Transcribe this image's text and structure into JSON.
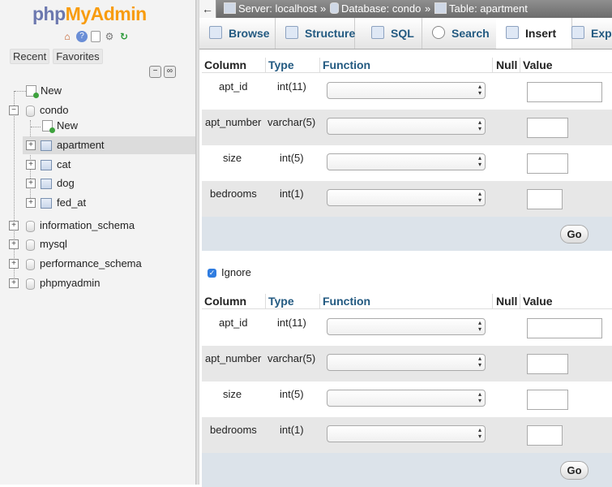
{
  "app": {
    "logo_part1": "php",
    "logo_part2": "MyAdmin"
  },
  "nav": {
    "icons": [
      "home-icon",
      "help-icon",
      "docs-icon",
      "settings-icon",
      "reload-icon"
    ],
    "tabs": [
      "Recent",
      "Favorites"
    ],
    "tree": {
      "new": "New",
      "databases": [
        {
          "name": "condo",
          "expanded": true,
          "new": "New",
          "tables": [
            "apartment",
            "cat",
            "dog",
            "fed_at"
          ],
          "selected_table": "apartment"
        },
        {
          "name": "information_schema"
        },
        {
          "name": "mysql"
        },
        {
          "name": "performance_schema"
        },
        {
          "name": "phpmyadmin"
        }
      ]
    }
  },
  "breadcrumb": {
    "server": "Server: localhost",
    "database": "Database: condo",
    "table": "Table: apartment",
    "separator": "»"
  },
  "tabs": [
    {
      "label": "Browse"
    },
    {
      "label": "Structure"
    },
    {
      "label": "SQL"
    },
    {
      "label": "Search"
    },
    {
      "label": "Insert",
      "active": true
    },
    {
      "label": "Exp"
    }
  ],
  "insert_form": {
    "headers": {
      "column": "Column",
      "type": "Type",
      "function": "Function",
      "null": "Null",
      "value": "Value"
    },
    "rows": [
      {
        "column": "apt_id",
        "type": "int(11)",
        "function": "",
        "value": ""
      },
      {
        "column": "apt_number",
        "type": "varchar(5)",
        "function": "",
        "value": ""
      },
      {
        "column": "size",
        "type": "int(5)",
        "function": "",
        "value": ""
      },
      {
        "column": "bedrooms",
        "type": "int(1)",
        "function": "",
        "value": ""
      }
    ],
    "go_label": "Go"
  },
  "ignore": {
    "label": "Ignore",
    "checked": true
  },
  "colors": {
    "link": "#235a81",
    "logo_php": "#6c78af",
    "logo_myadmin": "#f89c0e",
    "checkbox": "#2f7ce0"
  }
}
